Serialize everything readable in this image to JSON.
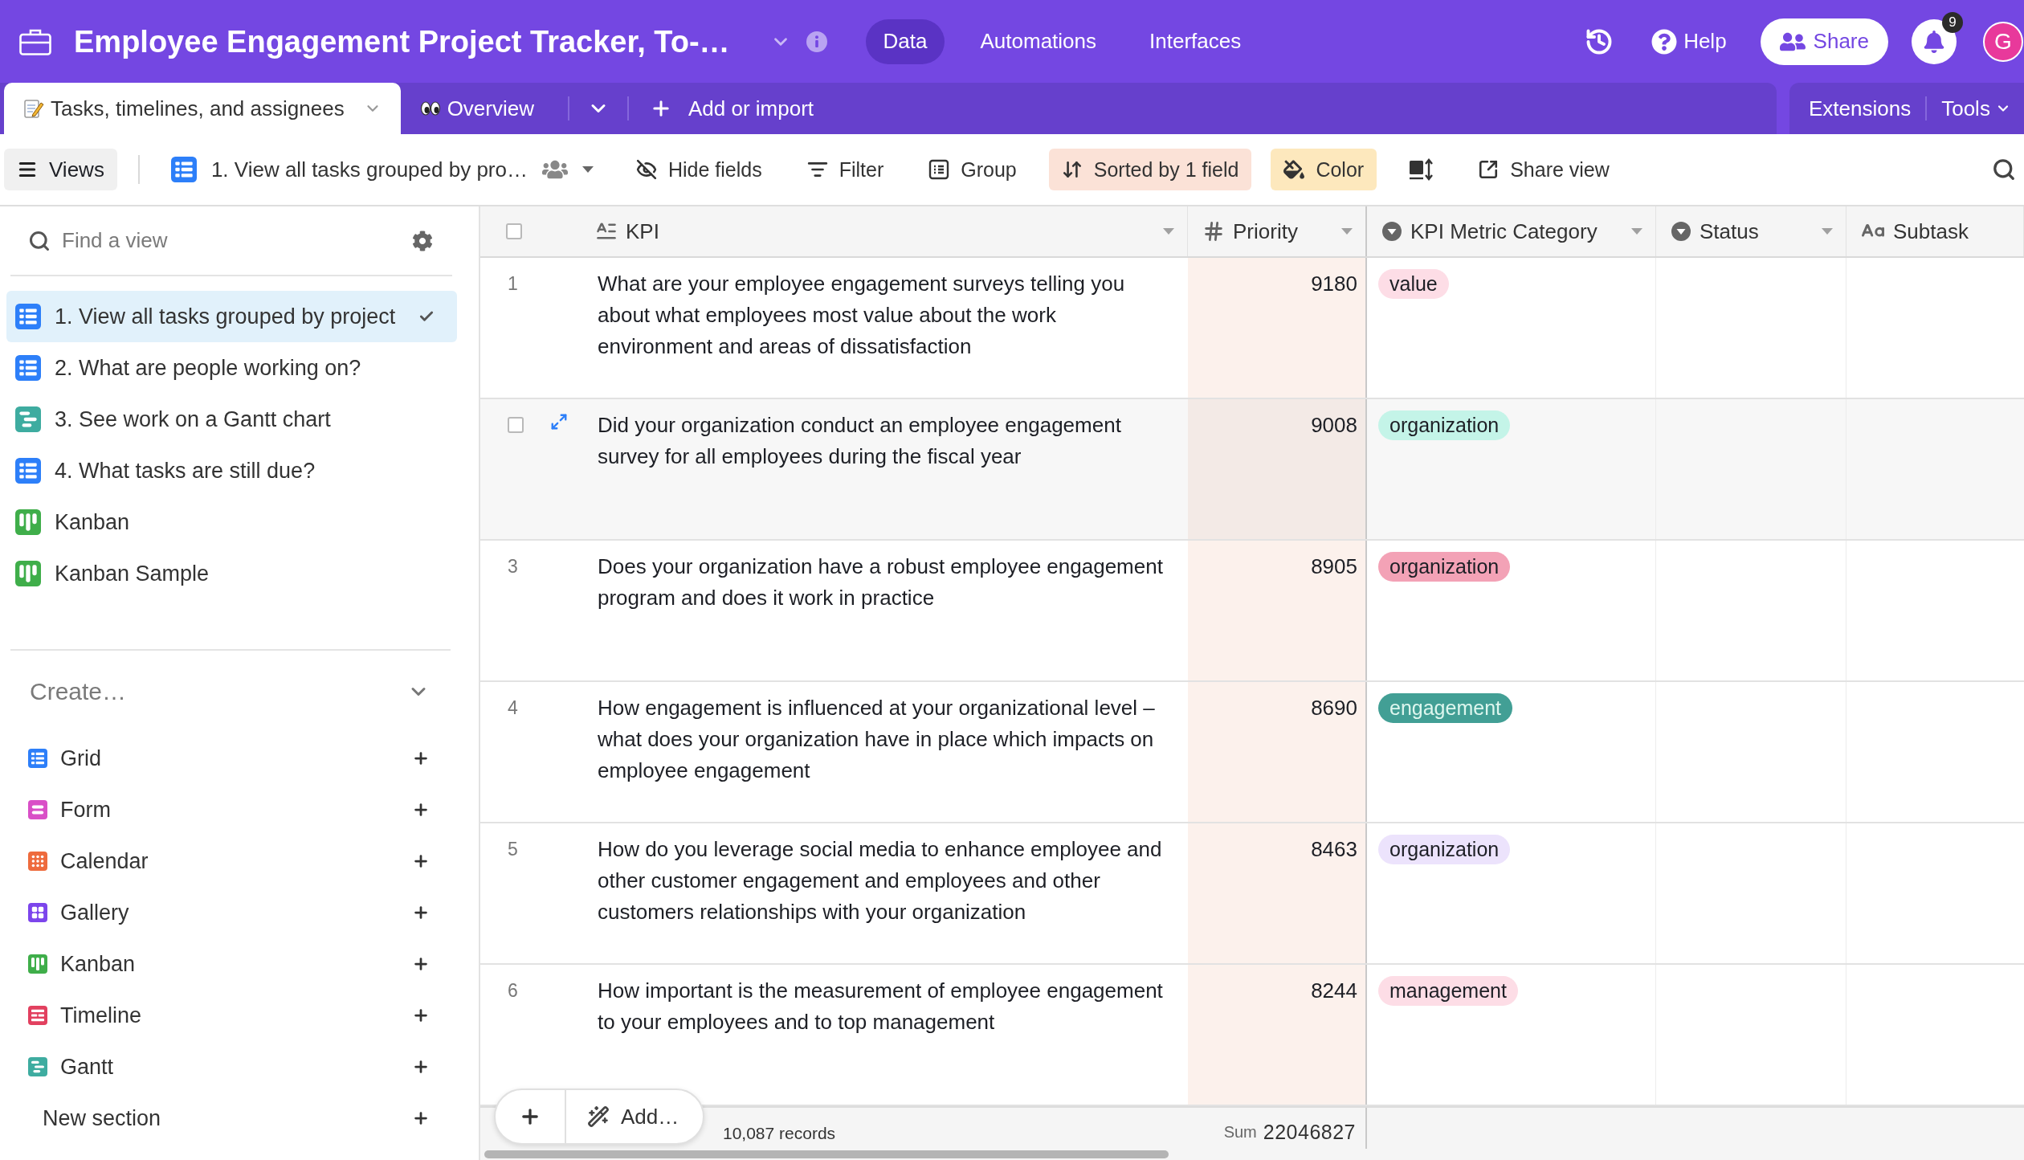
{
  "app_bar": {
    "base_title": "Employee Engagement Project Tracker, To-…",
    "nav": [
      {
        "label": "Data",
        "selected": true
      },
      {
        "label": "Automations",
        "selected": false
      },
      {
        "label": "Interfaces",
        "selected": false
      }
    ],
    "help": "Help",
    "share": "Share",
    "notifications": "9",
    "avatar": "G"
  },
  "table_tabs": {
    "tabs": [
      {
        "label": "Tasks, timelines, and assignees",
        "selected": true
      },
      {
        "label": "Overview",
        "selected": false
      }
    ],
    "add": "Add or import",
    "extensions": "Extensions",
    "tools": "Tools"
  },
  "toolbar": {
    "views": "Views",
    "view_name": "1. View all tasks grouped by pro…",
    "actions": [
      {
        "kind": "hide",
        "label": "Hide fields",
        "active": false
      },
      {
        "kind": "filter",
        "label": "Filter",
        "active": false
      },
      {
        "kind": "group",
        "label": "Group",
        "active": false
      },
      {
        "kind": "sort",
        "label": "Sorted by 1 field",
        "active": true
      },
      {
        "kind": "color",
        "label": "Color",
        "active": true
      },
      {
        "kind": "row-height",
        "active": false
      },
      {
        "kind": "share",
        "label": "Share view",
        "active": false
      }
    ]
  },
  "sidebar": {
    "search": {
      "placeholder": "Find a view"
    },
    "views": [
      {
        "kind": "grid",
        "label": "1. View all tasks grouped by project",
        "selected": true
      },
      {
        "kind": "grid",
        "label": "2. What are people working on?",
        "selected": false
      },
      {
        "kind": "gantt",
        "label": "3. See work on a Gantt chart",
        "selected": false
      },
      {
        "kind": "grid",
        "label": "4. What tasks are still due?",
        "selected": false
      },
      {
        "kind": "kanban",
        "label": "Kanban",
        "selected": false
      },
      {
        "kind": "kanban",
        "label": "Kanban Sample",
        "selected": false
      }
    ],
    "create": {
      "label": "Create…",
      "expanded": true,
      "items": [
        {
          "kind": "grid",
          "label": "Grid"
        },
        {
          "kind": "form",
          "label": "Form"
        },
        {
          "kind": "calendar",
          "label": "Calendar"
        },
        {
          "kind": "gallery",
          "label": "Gallery"
        },
        {
          "kind": "kanban",
          "label": "Kanban"
        },
        {
          "kind": "timeline",
          "label": "Timeline"
        },
        {
          "kind": "gantt",
          "label": "Gantt"
        }
      ]
    },
    "new_section": "New section"
  },
  "table": {
    "select_all": {
      "checked": false
    },
    "columns": [
      {
        "kind": "long-text",
        "name": "KPI"
      },
      {
        "kind": "number",
        "name": "Priority",
        "sorted": true
      },
      {
        "kind": "single-select",
        "name": "KPI Metric Category"
      },
      {
        "kind": "single-select",
        "name": "Status"
      },
      {
        "kind": "text",
        "name": "Subtask"
      }
    ],
    "rows": [
      {
        "number": "1",
        "hovered": false,
        "checked": false,
        "kpi": "What are your employee engagement surveys telling you about what employees most value about the work environment and areas of dissatisfaction",
        "priority": "9180",
        "category": {
          "label": "value",
          "color": "#fddde6"
        }
      },
      {
        "hovered": true,
        "checked": false,
        "kpi": "Did your organization conduct an employee engagement survey for all employees during the fiscal year",
        "priority": "9008",
        "category": {
          "label": "organization",
          "color": "#c4f4e8"
        }
      },
      {
        "number": "3",
        "hovered": false,
        "checked": false,
        "kpi": "Does your organization have a robust employee engagement program and does it work in practice",
        "priority": "8905",
        "category": {
          "label": "organization",
          "color": "#f3a2b6"
        }
      },
      {
        "number": "4",
        "hovered": false,
        "checked": false,
        "kpi": "How engagement is influenced at your organizational level – what does your organization have in place which impacts on employee engagement",
        "priority": "8690",
        "category": {
          "label": "engagement",
          "color": "#429f95"
        }
      },
      {
        "number": "5",
        "hovered": false,
        "checked": false,
        "kpi": "How do you leverage social media to enhance employee and other customer engagement and employees and other customers relationships with your organization",
        "priority": "8463",
        "category": {
          "label": "organization",
          "color": "#ece3fc"
        }
      },
      {
        "number": "6",
        "hovered": false,
        "checked": false,
        "kpi": "How important is the measurement of employee engagement to your employees and to top management",
        "priority": "8244",
        "category": {
          "label": "management",
          "color": "#fddde6"
        }
      }
    ],
    "footer": {
      "records": "10,087 records",
      "sum_label": "Sum",
      "sum": "22046827",
      "add": "Add…"
    }
  }
}
